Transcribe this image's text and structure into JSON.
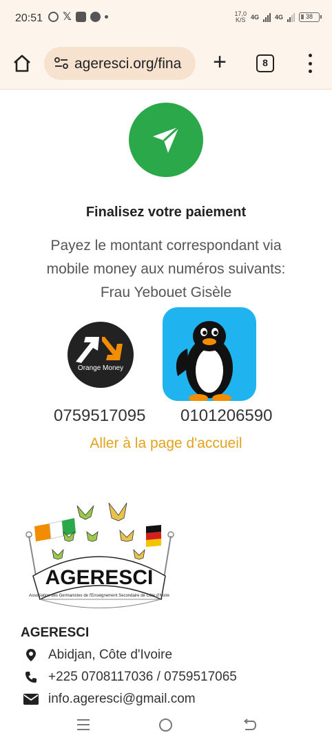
{
  "status_bar": {
    "time": "20:51",
    "speed_value": "17,0",
    "speed_unit": "K/S",
    "network1": "4G",
    "network2": "4G",
    "battery": "38",
    "icons": [
      "whatsapp-icon",
      "x-icon",
      "app-icon",
      "notification-icon",
      "dot-icon"
    ]
  },
  "browser": {
    "url": "ageresci.org/fina",
    "tab_count": "8"
  },
  "main": {
    "title": "Finalisez votre paiement",
    "description": "Payez le montant correspondant via mobile money aux numéros suivants:",
    "recipient": "Frau Yebouet Gisèle",
    "payment_methods": [
      {
        "logo": "orange-money-logo",
        "label": "Orange Money",
        "number": "0759517095"
      },
      {
        "logo": "penguin-app-logo",
        "number": "0101206590"
      }
    ],
    "home_link": "Aller à la page d'accueil"
  },
  "footer": {
    "logo_text": "AGERESCI",
    "logo_subtitle": "Association des Germanistes de l'Enseignement Secondaire de Côte d'Ivoire",
    "org_name": "AGERESCI",
    "address": "Abidjan, Côte d'Ivoire",
    "phone": "+225 0708117036 / 0759517065",
    "email": "info.ageresci@gmail.com"
  },
  "colors": {
    "accent_green": "#2aa84a",
    "link_orange": "#e5a11c",
    "toolbar_bg": "#fdf4ec",
    "orange_money": "#f28c00",
    "penguin_bg": "#1fb4ef"
  }
}
